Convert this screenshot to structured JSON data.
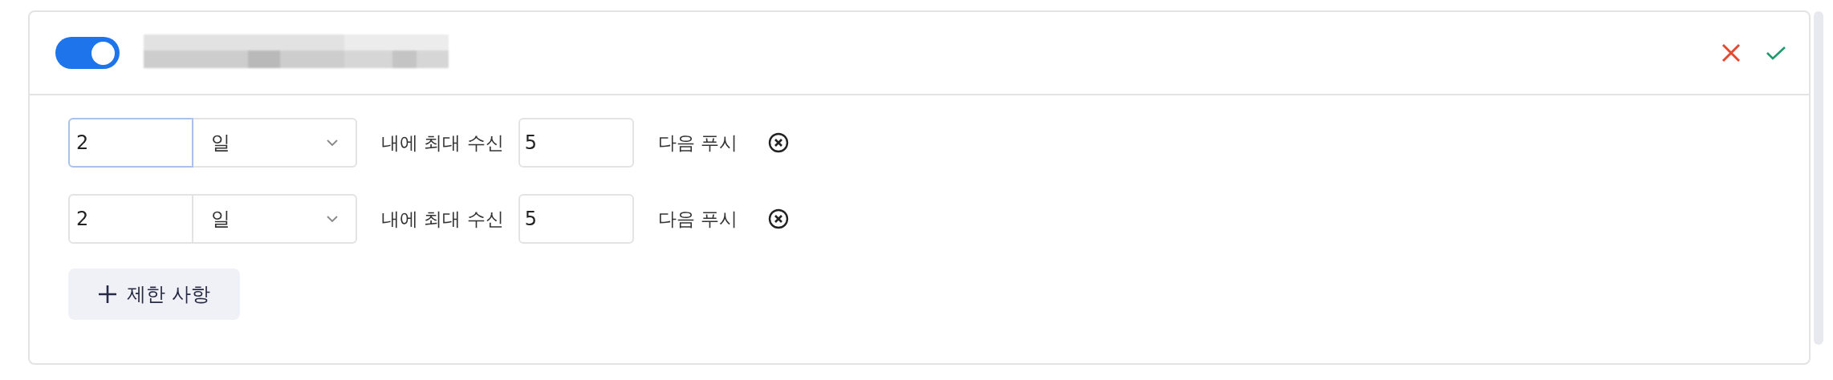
{
  "header": {
    "toggle": {
      "on": true
    }
  },
  "rules": [
    {
      "period": "2",
      "focused": true,
      "unit": "일",
      "middle_label": "내에 최대 수신",
      "count": "5",
      "suffix_label": "다음 푸시"
    },
    {
      "period": "2",
      "focused": false,
      "unit": "일",
      "middle_label": "내에 최대 수신",
      "count": "5",
      "suffix_label": "다음 푸시"
    }
  ],
  "add_button": {
    "label": "제한 사항"
  }
}
